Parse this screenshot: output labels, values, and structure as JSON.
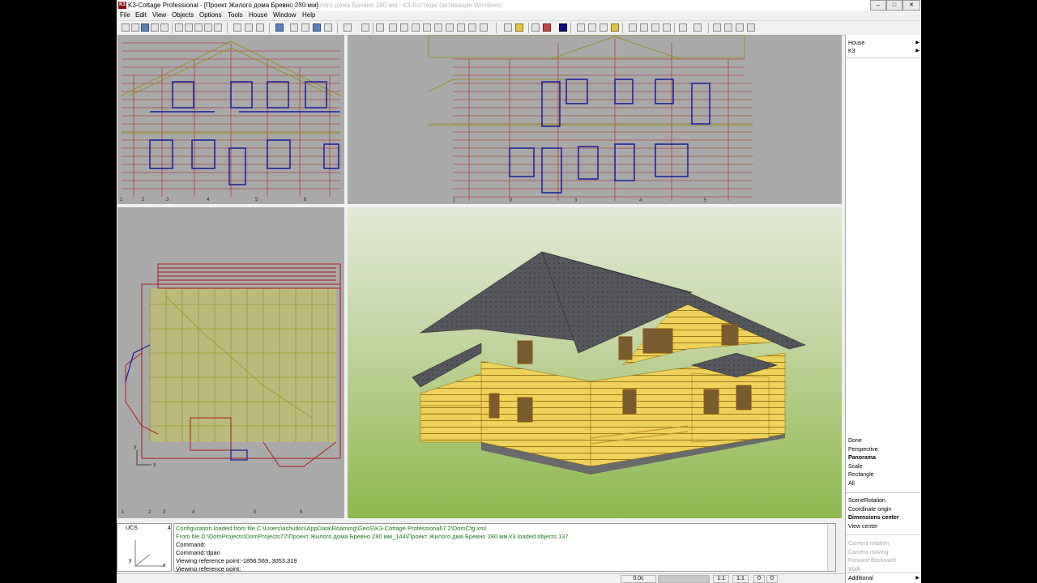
{
  "window": {
    "app_title": "K3-Cottage Professional - [Проект Жилого дома Бревно 280 мм]",
    "logo_text": "K3",
    "faded_text": "Проект Жилого дома Бревно 280 мм - К3-Коттедж (активация Windows)",
    "minimize": "–",
    "maximize": "□",
    "close": "✕"
  },
  "menu": [
    "File",
    "Edit",
    "View",
    "Objects",
    "Options",
    "Tools",
    "House",
    "Window",
    "Help"
  ],
  "right_panel": {
    "top_items": [
      "House",
      "K3"
    ],
    "view_items": [
      {
        "label": "Done",
        "bold": false
      },
      {
        "label": "Perspective",
        "bold": false
      },
      {
        "label": "Panorama",
        "bold": true
      },
      {
        "label": "Scale",
        "bold": false
      },
      {
        "label": "Rectangle",
        "bold": false
      },
      {
        "label": "All",
        "bold": false
      }
    ],
    "nav_items": [
      {
        "label": "SceneRotation",
        "bold": false
      },
      {
        "label": "Coordinate origin",
        "bold": false
      },
      {
        "label": "Dimensions center",
        "bold": true
      },
      {
        "label": "View center",
        "bold": false
      }
    ],
    "disabled_items": [
      "Camera rotation",
      "Camera moving",
      "Forward-Backward",
      "Walk"
    ],
    "additional": "Additional"
  },
  "ucs": {
    "label": "UCS",
    "number": "4",
    "x_axis": "x",
    "y_axis": "y"
  },
  "console": {
    "lines": [
      {
        "text": "Configuration loaded from file C:\\Users\\ashutkin\\AppData\\Roaming\\GeoS\\K3-Cottage Professional\\7.2\\DomCfg.xml",
        "color": "green"
      },
      {
        "text": "From file D:\\DomProjects\\DomProjects72\\Проект Жилого дома Бревно 280 мм_144\\Проект Жилого дма Бревно 280 мм.k3 loaded objects 137",
        "color": "green"
      },
      {
        "text": "Command:",
        "color": "black"
      },
      {
        "text": "Command:'dpan",
        "color": "black"
      },
      {
        "text": "Viewing reference point:-1856.569, 3053.319",
        "color": "black"
      },
      {
        "text": "Viewing reference point:",
        "color": "black"
      }
    ]
  },
  "status": {
    "angle": "0.0c",
    "scale1": "1:1",
    "scale2": "1:1",
    "v1": "0",
    "v2": "0"
  },
  "plan_view": {
    "x_label": "x",
    "y_label": "y"
  },
  "colors": {
    "log_fill": "#f0d25a",
    "log_stroke": "#8a6a10",
    "roof": "#55575d",
    "elevation_red": "#b0181a",
    "elevation_blue": "#1a1a9a",
    "elevation_olive": "#8c8c14"
  }
}
